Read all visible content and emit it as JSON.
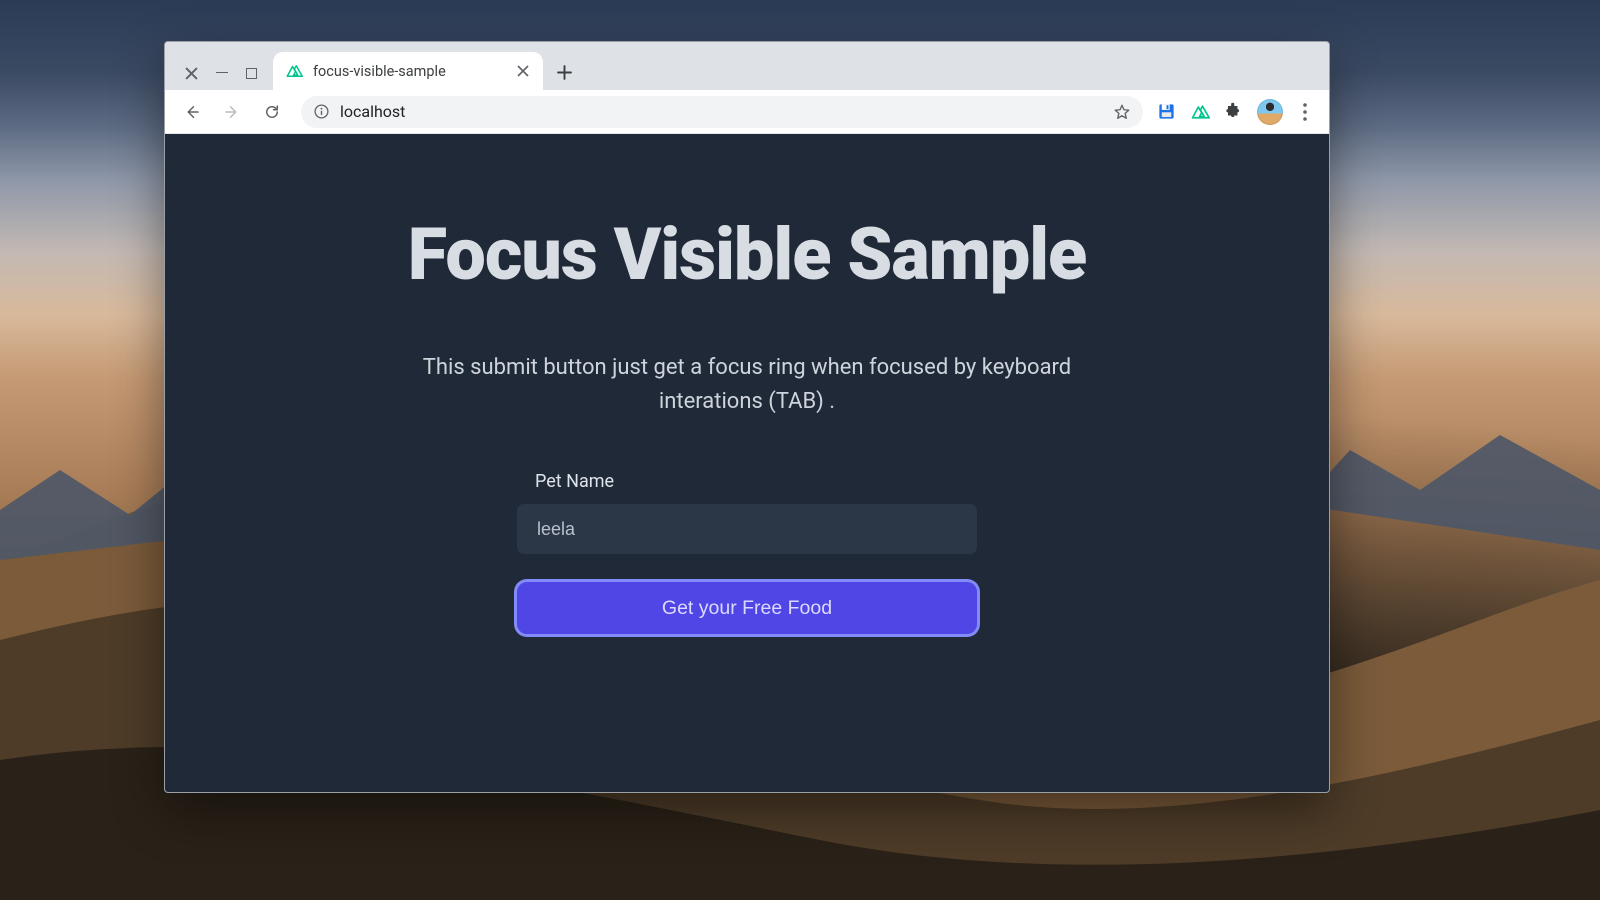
{
  "browser": {
    "tab_title": "focus-visible-sample",
    "url": "localhost"
  },
  "page": {
    "heading": "Focus Visible Sample",
    "description": "This submit button just get a focus ring when focused by keyboard interations (TAB) .",
    "form": {
      "label": "Pet Name",
      "input_value": "leela",
      "submit_label": "Get your Free Food"
    }
  },
  "colors": {
    "page_bg": "#1f2937",
    "accent": "#4f46e5",
    "focus_ring": "#818cf8"
  }
}
